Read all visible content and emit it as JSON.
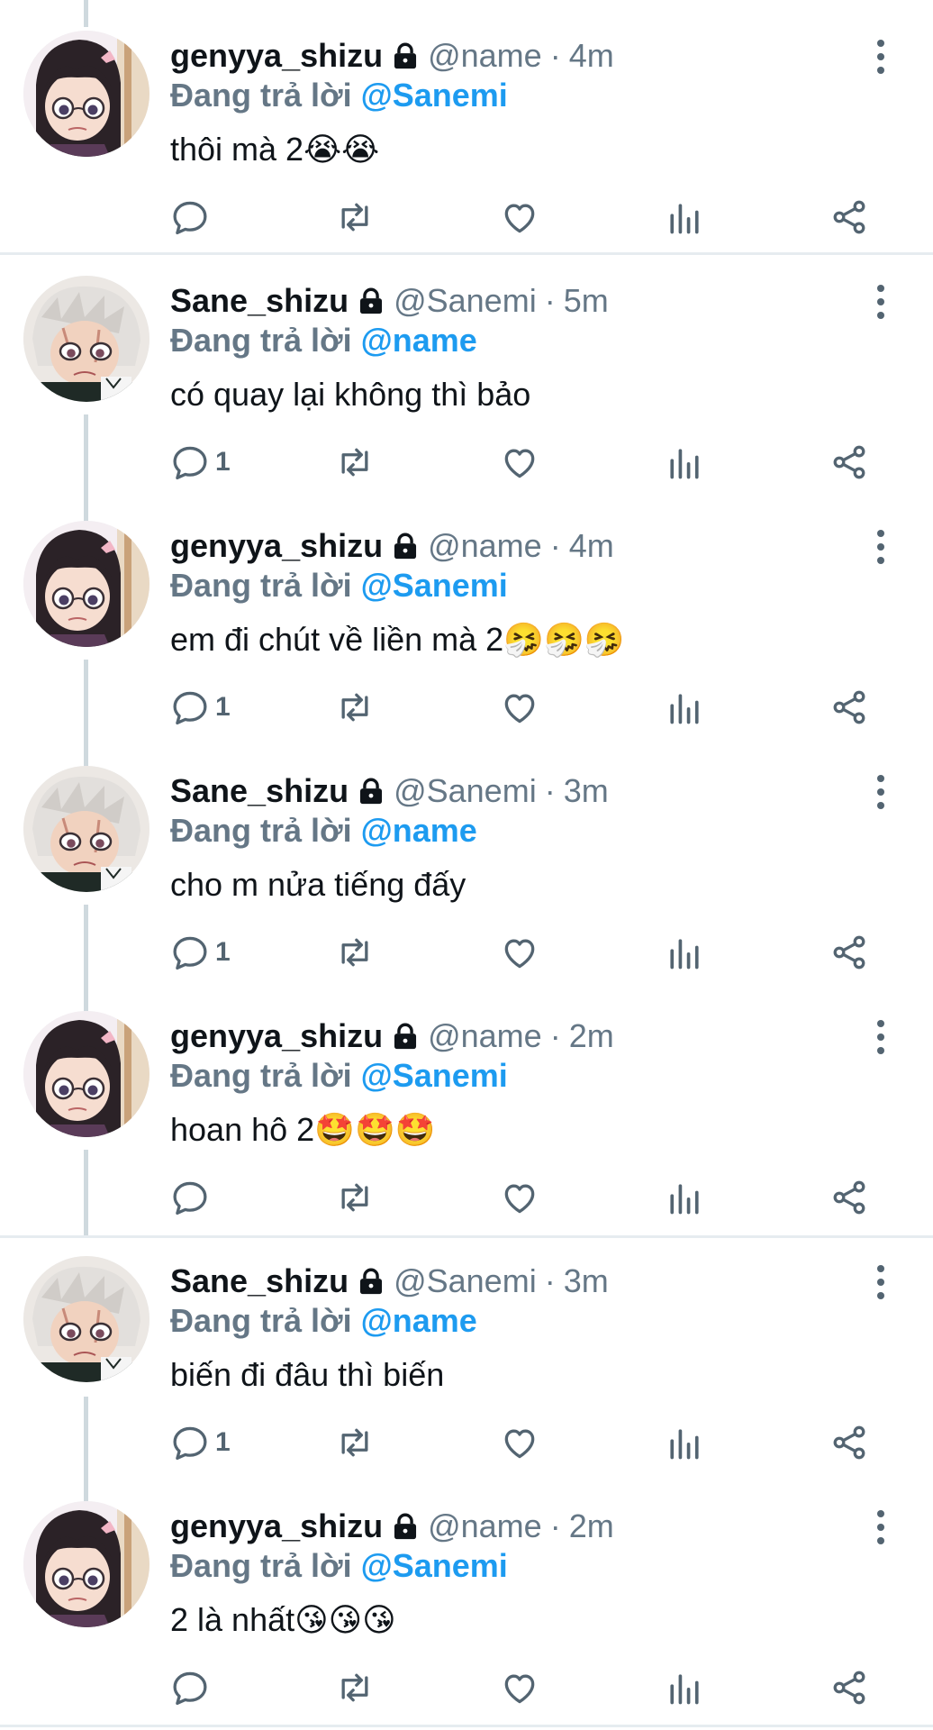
{
  "reply_prefix": "Đang trả lời",
  "tweets": [
    {
      "author": "genyya_shizu",
      "handle": "@name",
      "time": "4m",
      "reply_to": "@Sanemi",
      "text": "thôi mà 2😭😭",
      "reply_count": "",
      "avatar": "genyya"
    },
    {
      "author": "Sane_shizu",
      "handle": "@Sanemi",
      "time": "5m",
      "reply_to": "@name",
      "text": "có quay lại không thì bảo",
      "reply_count": "1",
      "avatar": "sane"
    },
    {
      "author": "genyya_shizu",
      "handle": "@name",
      "time": "4m",
      "reply_to": "@Sanemi",
      "text": "em đi chút về liền mà 2🤧🤧🤧",
      "reply_count": "1",
      "avatar": "genyya"
    },
    {
      "author": "Sane_shizu",
      "handle": "@Sanemi",
      "time": "3m",
      "reply_to": "@name",
      "text": "cho m nửa tiếng đấy",
      "reply_count": "1",
      "avatar": "sane"
    },
    {
      "author": "genyya_shizu",
      "handle": "@name",
      "time": "2m",
      "reply_to": "@Sanemi",
      "text": "hoan hô 2🤩🤩🤩",
      "reply_count": "",
      "avatar": "genyya"
    },
    {
      "author": "Sane_shizu",
      "handle": "@Sanemi",
      "time": "3m",
      "reply_to": "@name",
      "text": "biến đi đâu thì biến",
      "reply_count": "1",
      "avatar": "sane"
    },
    {
      "author": "genyya_shizu",
      "handle": "@name",
      "time": "2m",
      "reply_to": "@Sanemi",
      "text": "2 là nhất😘😘😘",
      "reply_count": "",
      "avatar": "genyya"
    }
  ],
  "icons": {
    "lock": "lock-icon",
    "more": "more-vertical-icon",
    "reply": "reply-icon",
    "retweet": "retweet-icon",
    "like": "heart-icon",
    "views": "views-icon",
    "share": "share-icon"
  },
  "colors": {
    "mention": "#1d9bf0",
    "secondary_text": "#657786",
    "divider": "#e6ecf0",
    "thread_line": "#cfd9de"
  }
}
